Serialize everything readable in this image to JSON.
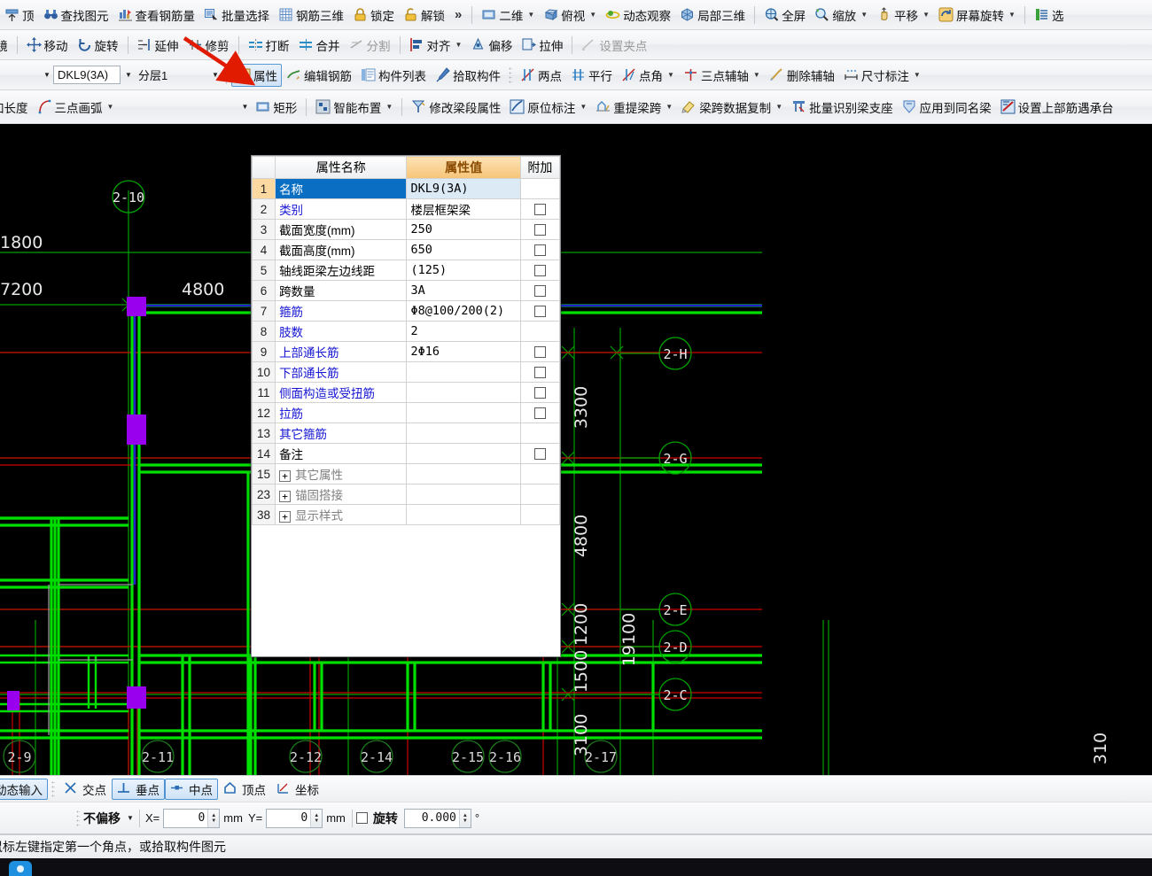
{
  "toolbar_row1": [
    {
      "label": "顶",
      "icon": "top-icon",
      "type": "button"
    },
    {
      "label": "查找图元",
      "icon": "binocular-icon",
      "type": "button"
    },
    {
      "label": "查看钢筋量",
      "icon": "rebar-qty-icon",
      "type": "button"
    },
    {
      "label": "批量选择",
      "icon": "batch-select-icon",
      "type": "button"
    },
    {
      "label": "钢筋三维",
      "icon": "rebar-3d-icon",
      "type": "button"
    },
    {
      "label": "锁定",
      "icon": "lock-icon",
      "type": "button"
    },
    {
      "label": "解锁",
      "icon": "unlock-icon",
      "type": "button"
    },
    {
      "label": "»",
      "icon": "overflow-chevron-icon",
      "type": "chevron"
    },
    {
      "label": "二维",
      "icon": "view-2d-icon",
      "type": "dropdown"
    },
    {
      "label": "俯视",
      "icon": "top-view-icon",
      "type": "dropdown"
    },
    {
      "label": "动态观察",
      "icon": "orbit-icon",
      "type": "button"
    },
    {
      "label": "局部三维",
      "icon": "local-3d-icon",
      "type": "button"
    },
    {
      "label": "全屏",
      "icon": "fullscreen-icon",
      "type": "button"
    },
    {
      "label": "缩放",
      "icon": "zoom-icon",
      "type": "dropdown"
    },
    {
      "label": "平移",
      "icon": "pan-icon",
      "type": "dropdown"
    },
    {
      "label": "屏幕旋转",
      "icon": "screen-rotate-icon",
      "type": "dropdown"
    },
    {
      "label": "选",
      "icon": "select-icon",
      "type": "button"
    }
  ],
  "toolbar_row2": [
    {
      "label": "镜",
      "icon": "mirror-icon",
      "type": "button",
      "partial": true
    },
    {
      "label": "移动",
      "icon": "move-icon",
      "type": "button"
    },
    {
      "label": "旋转",
      "icon": "rotate-icon",
      "type": "button"
    },
    {
      "label": "延伸",
      "icon": "extend-icon",
      "type": "button"
    },
    {
      "label": "修剪",
      "icon": "trim-icon",
      "type": "button"
    },
    {
      "label": "打断",
      "icon": "break-icon",
      "type": "button"
    },
    {
      "label": "合并",
      "icon": "merge-icon",
      "type": "button"
    },
    {
      "label": "分割",
      "icon": "split-icon",
      "type": "button",
      "disabled": true
    },
    {
      "label": "对齐",
      "icon": "align-icon",
      "type": "dropdown"
    },
    {
      "label": "偏移",
      "icon": "offset-icon",
      "type": "button"
    },
    {
      "label": "拉伸",
      "icon": "stretch-icon",
      "type": "button"
    },
    {
      "label": "设置夹点",
      "icon": "set-grip-icon",
      "type": "button",
      "disabled": true
    }
  ],
  "toolbar_row3": {
    "component_combo": {
      "value": "DKL9(3A)",
      "name": "component-name-combo"
    },
    "layer_combo": {
      "value": "分层1",
      "name": "layer-combo"
    },
    "items": [
      {
        "label": "属性",
        "icon": "properties-icon",
        "type": "toggle",
        "active": true
      },
      {
        "label": "编辑钢筋",
        "icon": "edit-rebar-icon",
        "type": "button"
      },
      {
        "label": "构件列表",
        "icon": "component-list-icon",
        "type": "button"
      },
      {
        "label": "拾取构件",
        "icon": "pick-component-icon",
        "type": "button"
      },
      {
        "label": "两点",
        "icon": "two-point-icon",
        "type": "button"
      },
      {
        "label": "平行",
        "icon": "parallel-icon",
        "type": "button"
      },
      {
        "label": "点角",
        "icon": "point-angle-icon",
        "type": "dropdown"
      },
      {
        "label": "三点辅轴",
        "icon": "three-point-axis-icon",
        "type": "dropdown"
      },
      {
        "label": "删除辅轴",
        "icon": "delete-axis-icon",
        "type": "button"
      },
      {
        "label": "尺寸标注",
        "icon": "dimension-icon",
        "type": "dropdown"
      }
    ]
  },
  "toolbar_row4": {
    "blank_combo": {
      "value": "",
      "name": "style-combo"
    },
    "items": [
      {
        "label": "加长度",
        "icon": "add-length-icon",
        "type": "button",
        "partial": true
      },
      {
        "label": "三点画弧",
        "icon": "three-point-arc-icon",
        "type": "dropdown"
      },
      {
        "label": "矩形",
        "icon": "rectangle-icon",
        "type": "button"
      },
      {
        "label": "智能布置",
        "icon": "smart-layout-icon",
        "type": "dropdown"
      },
      {
        "label": "修改梁段属性",
        "icon": "edit-beam-segment-icon",
        "type": "button"
      },
      {
        "label": "原位标注",
        "icon": "in-situ-label-icon",
        "type": "dropdown"
      },
      {
        "label": "重提梁跨",
        "icon": "reextract-span-icon",
        "type": "dropdown"
      },
      {
        "label": "梁跨数据复制",
        "icon": "copy-span-data-icon",
        "type": "dropdown"
      },
      {
        "label": "批量识别梁支座",
        "icon": "batch-identify-support-icon",
        "type": "button"
      },
      {
        "label": "应用到同名梁",
        "icon": "apply-same-name-icon",
        "type": "button"
      },
      {
        "label": "设置上部筋遇承台",
        "icon": "set-top-rebar-icon",
        "type": "button",
        "partial": true
      }
    ]
  },
  "properties_panel": {
    "headers": {
      "index": "",
      "name": "属性名称",
      "value": "属性值",
      "extra": "附加"
    },
    "rows": [
      {
        "idx": "1",
        "name": "名称",
        "value": "DKL9(3A)",
        "blue": true,
        "selected": true,
        "checkbox": false
      },
      {
        "idx": "2",
        "name": "类别",
        "value": "楼层框架梁",
        "blue": true,
        "checkbox": true
      },
      {
        "idx": "3",
        "name": "截面宽度(mm)",
        "value": "250",
        "blue": false,
        "checkbox": true
      },
      {
        "idx": "4",
        "name": "截面高度(mm)",
        "value": "650",
        "blue": false,
        "checkbox": true
      },
      {
        "idx": "5",
        "name": "轴线距梁左边线距",
        "value": "(125)",
        "blue": false,
        "checkbox": true
      },
      {
        "idx": "6",
        "name": "跨数量",
        "value": "3A",
        "blue": false,
        "checkbox": true
      },
      {
        "idx": "7",
        "name": "箍筋",
        "value": "Φ8@100/200(2)",
        "blue": true,
        "checkbox": true
      },
      {
        "idx": "8",
        "name": "肢数",
        "value": "2",
        "blue": true,
        "checkbox": false
      },
      {
        "idx": "9",
        "name": "上部通长筋",
        "value": "2Φ16",
        "blue": true,
        "checkbox": true
      },
      {
        "idx": "10",
        "name": "下部通长筋",
        "value": "",
        "blue": true,
        "checkbox": true
      },
      {
        "idx": "11",
        "name": "侧面构造或受扭筋",
        "value": "",
        "blue": true,
        "checkbox": true
      },
      {
        "idx": "12",
        "name": "拉筋",
        "value": "",
        "blue": true,
        "checkbox": true
      },
      {
        "idx": "13",
        "name": "其它箍筋",
        "value": "",
        "blue": true,
        "checkbox": false
      },
      {
        "idx": "14",
        "name": "备注",
        "value": "",
        "blue": false,
        "checkbox": true
      },
      {
        "idx": "15",
        "name": "其它属性",
        "value": "",
        "grey": true,
        "expand": "+",
        "checkbox": false
      },
      {
        "idx": "23",
        "name": "锚固搭接",
        "value": "",
        "grey": true,
        "expand": "+",
        "checkbox": false
      },
      {
        "idx": "38",
        "name": "显示样式",
        "value": "",
        "grey": true,
        "expand": "+",
        "checkbox": false
      }
    ]
  },
  "snap_bar": {
    "dynamic_input": {
      "label": "动态输入",
      "on": true,
      "name": "dynamic-input-toggle"
    },
    "snaps": [
      {
        "label": "交点",
        "icon": "intersection-icon",
        "on": false
      },
      {
        "label": "垂点",
        "icon": "perpendicular-icon",
        "on": true
      },
      {
        "label": "中点",
        "icon": "midpoint-icon",
        "on": true
      },
      {
        "label": "顶点",
        "icon": "vertex-icon",
        "on": false
      },
      {
        "label": "坐标",
        "icon": "coordinate-icon",
        "on": false
      }
    ]
  },
  "offset_bar": {
    "mode": "不偏移",
    "x_label": "X=",
    "x_value": "0",
    "x_unit": "mm",
    "y_label": "Y=",
    "y_value": "0",
    "y_unit": "mm",
    "rotate_label": "旋转",
    "rotate_value": "0.000",
    "rotate_unit": "°"
  },
  "status_bar": {
    "text": "鼠标左键指定第一个角点，或拾取构件图元"
  },
  "canvas": {
    "dimensions_top": [
      "1800",
      "7200",
      "4800"
    ],
    "dimensions_right": [
      "3300",
      "4800",
      "1200",
      "1500",
      "19100",
      "3100"
    ],
    "axis_labels_right": [
      "2-H",
      "2-G",
      "2-E",
      "2-D",
      "2-C"
    ],
    "axis_labels_top": [
      "2-10"
    ],
    "axis_labels_bottom": [
      "2-9",
      "2-11",
      "2-12",
      "2-14",
      "2-15",
      "2-16",
      "2-17"
    ],
    "colors": {
      "background": "#000000",
      "beam": "#00e000",
      "axis": "#00a000",
      "grid_red": "#cc0000",
      "selected_beam": "#2222cc",
      "support": "#9900ee",
      "text": "#e8e8e8"
    }
  },
  "annotation": {
    "arrow_color": "#e01b00",
    "points_to": "属性"
  }
}
